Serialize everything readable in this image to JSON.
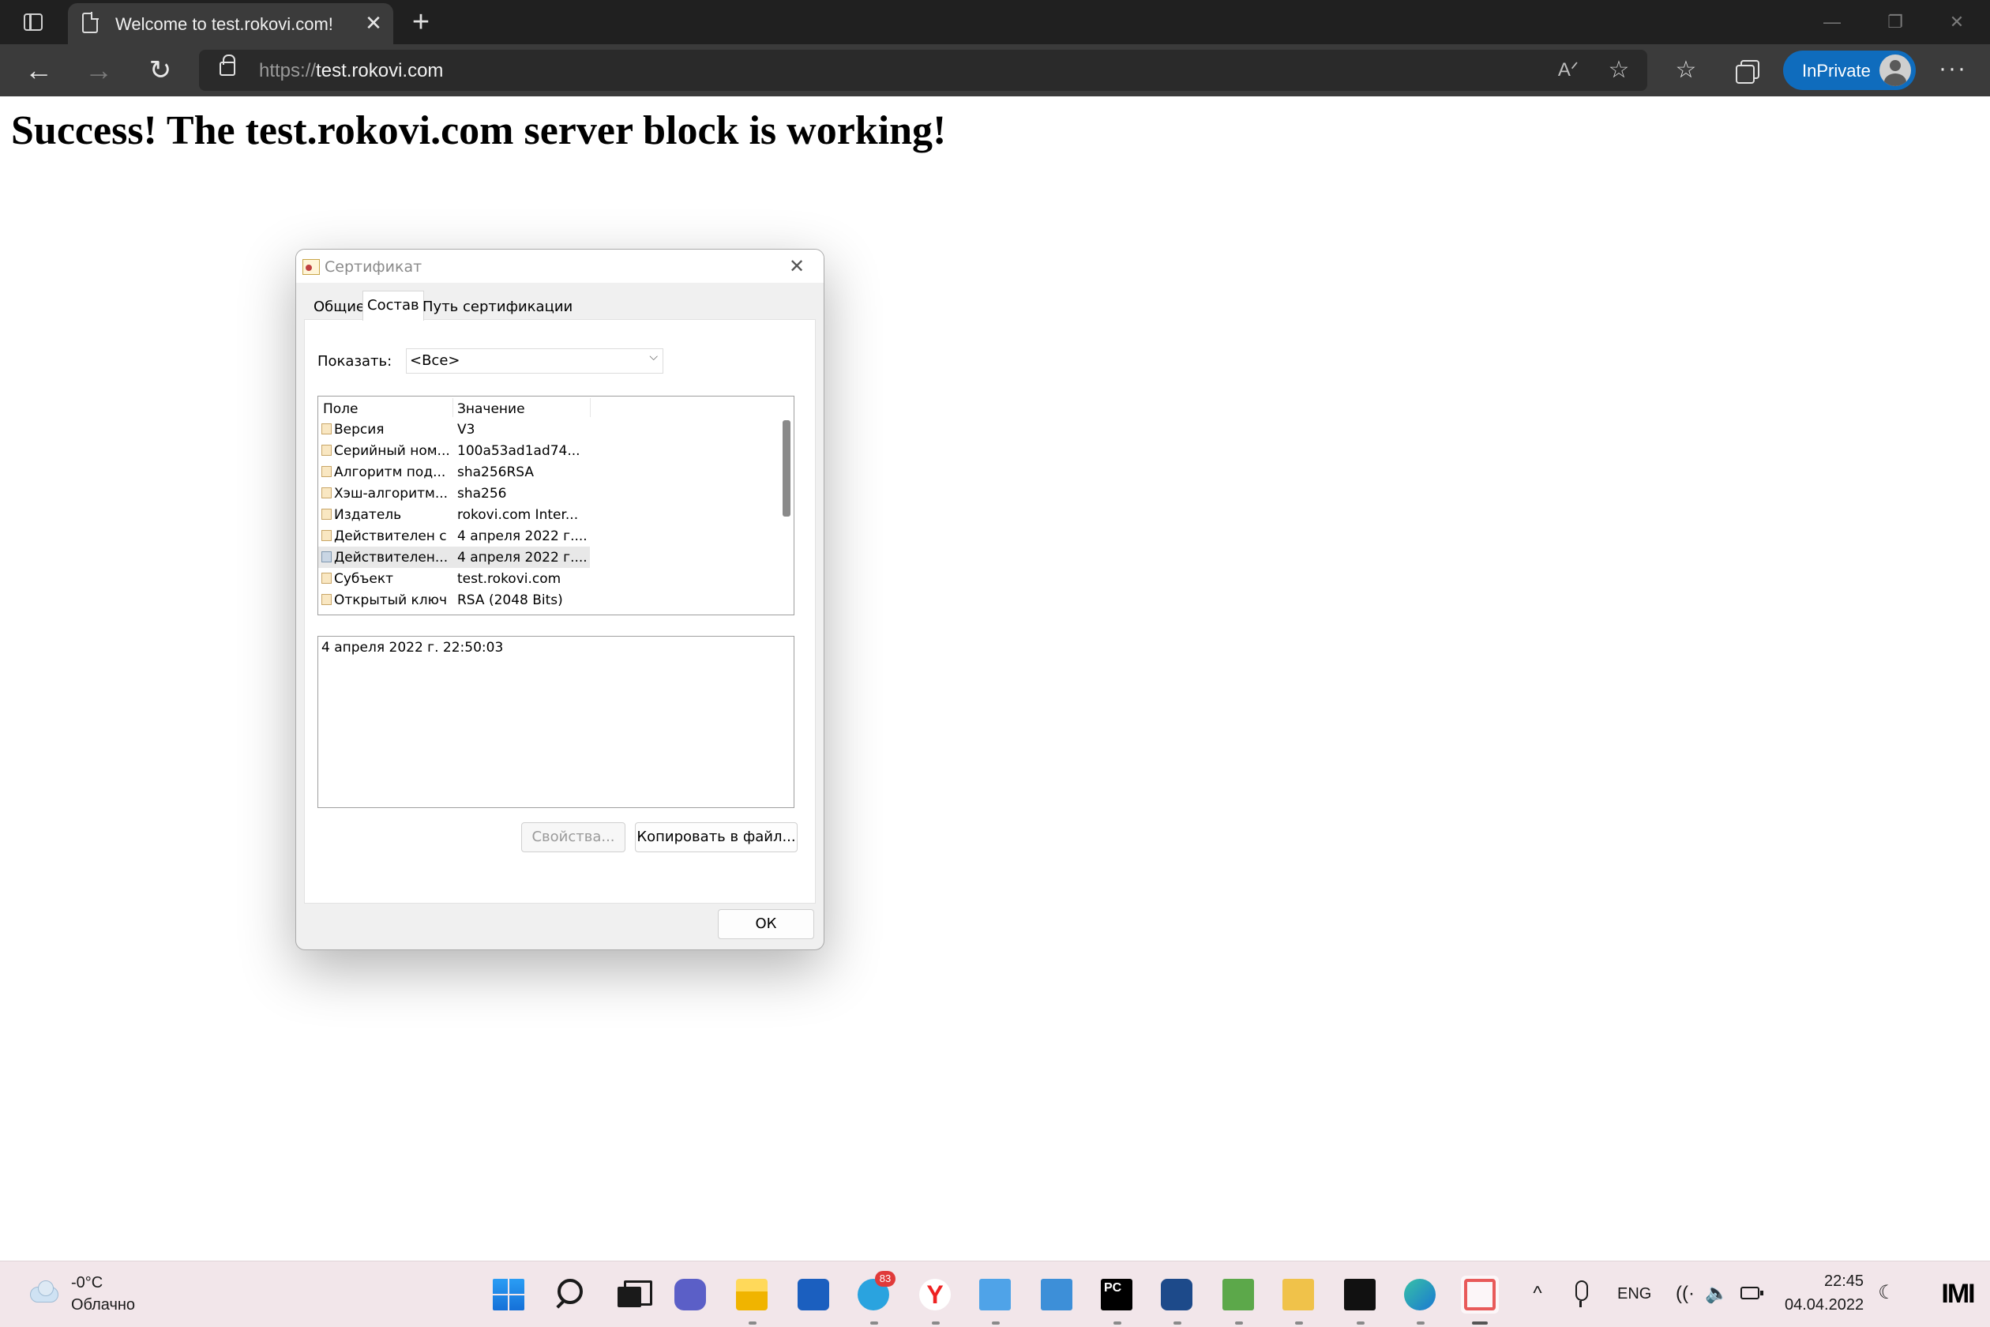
{
  "browser": {
    "tab_title": "Welcome to test.rokovi.com!",
    "tab_close_glyph": "✕",
    "new_tab_glyph": "+",
    "url_scheme": "https://",
    "url_host": "test.rokovi.com",
    "inprivate_label": "InPrivate",
    "window_controls": {
      "minimize": "—",
      "maximize": "❐",
      "close": "✕"
    },
    "toolbar_glyphs": {
      "back": "←",
      "forward": "→",
      "refresh": "↻",
      "read_aloud": "Aᐟ",
      "add_favorite": "☆",
      "favorites": "☆",
      "more": "···"
    }
  },
  "page": {
    "heading": "Success! The test.rokovi.com server block is working!"
  },
  "dialog": {
    "title": "Сертификат",
    "close_glyph": "✕",
    "tabs": [
      "Общие",
      "Состав",
      "Путь сертификации"
    ],
    "active_tab": "Состав",
    "show_label": "Показать:",
    "show_value": "<Все>",
    "columns": {
      "field": "Поле",
      "value": "Значение"
    },
    "rows": [
      {
        "field": "Версия",
        "value": "V3"
      },
      {
        "field": "Серийный ном...",
        "value": "100a53ad1ad74..."
      },
      {
        "field": "Алгоритм под...",
        "value": "sha256RSA"
      },
      {
        "field": "Хэш-алгоритм...",
        "value": "sha256"
      },
      {
        "field": "Издатель",
        "value": "rokovi.com Inter..."
      },
      {
        "field": "Действителен с",
        "value": "4 апреля 2022 г...."
      },
      {
        "field": "Действителен...",
        "value": "4 апреля 2022 г...."
      },
      {
        "field": "Субъект",
        "value": "test.rokovi.com"
      },
      {
        "field": "Открытый ключ",
        "value": "RSA (2048 Bits)"
      }
    ],
    "selected_row_index": 6,
    "detail_text": "4 апреля 2022 г. 22:50:03",
    "properties_button": "Свойства...",
    "copy_button": "Копировать в файл...",
    "ok_button": "ОК"
  },
  "taskbar": {
    "weather_temp": "-0°C",
    "weather_desc": "Облачно",
    "apps": [
      "start",
      "search",
      "task-view",
      "teams-chat",
      "file-explorer",
      "microsoft-store",
      "telegram",
      "yandex-browser",
      "notepad",
      "remote-desktop",
      "pycharm",
      "virtualbox",
      "editor",
      "network-tool",
      "terminal",
      "edge",
      "snipping-tool"
    ],
    "telegram_badge": "83",
    "yandex_glyph": "Y",
    "pycharm_glyph": "PC",
    "language": "ENG",
    "time": "22:45",
    "date": "04.04.2022",
    "logo_text": "IMI",
    "tray_glyphs": {
      "chevron": "^",
      "wifi": "((·",
      "volume": "🔈",
      "focus": "☾"
    }
  }
}
